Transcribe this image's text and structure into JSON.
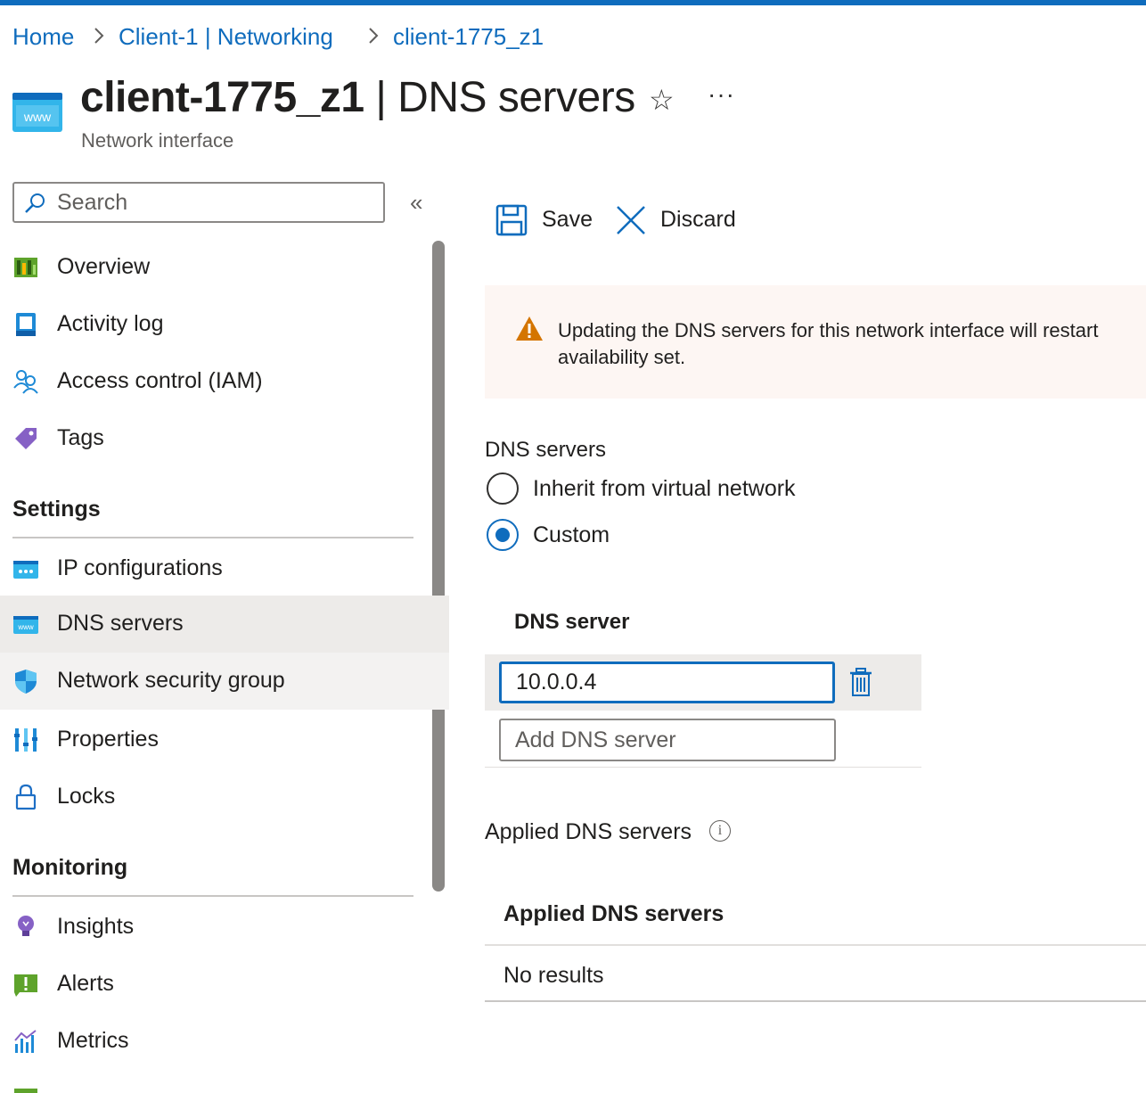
{
  "colors": {
    "accent": "#0f6cbd",
    "warning": "#d47500",
    "selected_row": "#edebe9"
  },
  "breadcrumb": [
    "Home",
    "Client-1 | Networking",
    "client-1775_z1"
  ],
  "header": {
    "resource_name": "client-1775_z1",
    "separator": " | ",
    "page_name": "DNS servers",
    "subtitle": "Network interface",
    "icon_text": "www",
    "star": "☆",
    "more": "···"
  },
  "search": {
    "placeholder": "Search"
  },
  "sidebar": {
    "collapse": "«",
    "items": [
      {
        "label": "Overview",
        "icon": "overview-icon"
      },
      {
        "label": "Activity log",
        "icon": "activity-log-icon"
      },
      {
        "label": "Access control (IAM)",
        "icon": "iam-icon"
      },
      {
        "label": "Tags",
        "icon": "tag-icon"
      }
    ],
    "settings_title": "Settings",
    "settings_items": [
      {
        "label": "IP configurations",
        "icon": "ip-config-icon"
      },
      {
        "label": "DNS servers",
        "icon": "dns-icon",
        "selected": true
      },
      {
        "label": "Network security group",
        "icon": "shield-icon"
      },
      {
        "label": "Properties",
        "icon": "properties-icon"
      },
      {
        "label": "Locks",
        "icon": "lock-icon"
      }
    ],
    "monitoring_title": "Monitoring",
    "monitoring_items": [
      {
        "label": "Insights",
        "icon": "lightbulb-icon"
      },
      {
        "label": "Alerts",
        "icon": "alert-icon"
      },
      {
        "label": "Metrics",
        "icon": "metrics-icon"
      }
    ]
  },
  "toolbar": {
    "save": "Save",
    "discard": "Discard"
  },
  "warning": {
    "line1": "Updating the DNS servers for this network interface will restart",
    "line2": "availability set."
  },
  "dns": {
    "section_label": "DNS servers",
    "options": [
      "Inherit from virtual network",
      "Custom"
    ],
    "selected": "Custom",
    "column_header": "DNS server",
    "servers": [
      "10.0.0.4"
    ],
    "add_placeholder": "Add DNS server"
  },
  "applied": {
    "label": "Applied DNS servers",
    "table_header": "Applied DNS servers",
    "empty": "No results"
  }
}
